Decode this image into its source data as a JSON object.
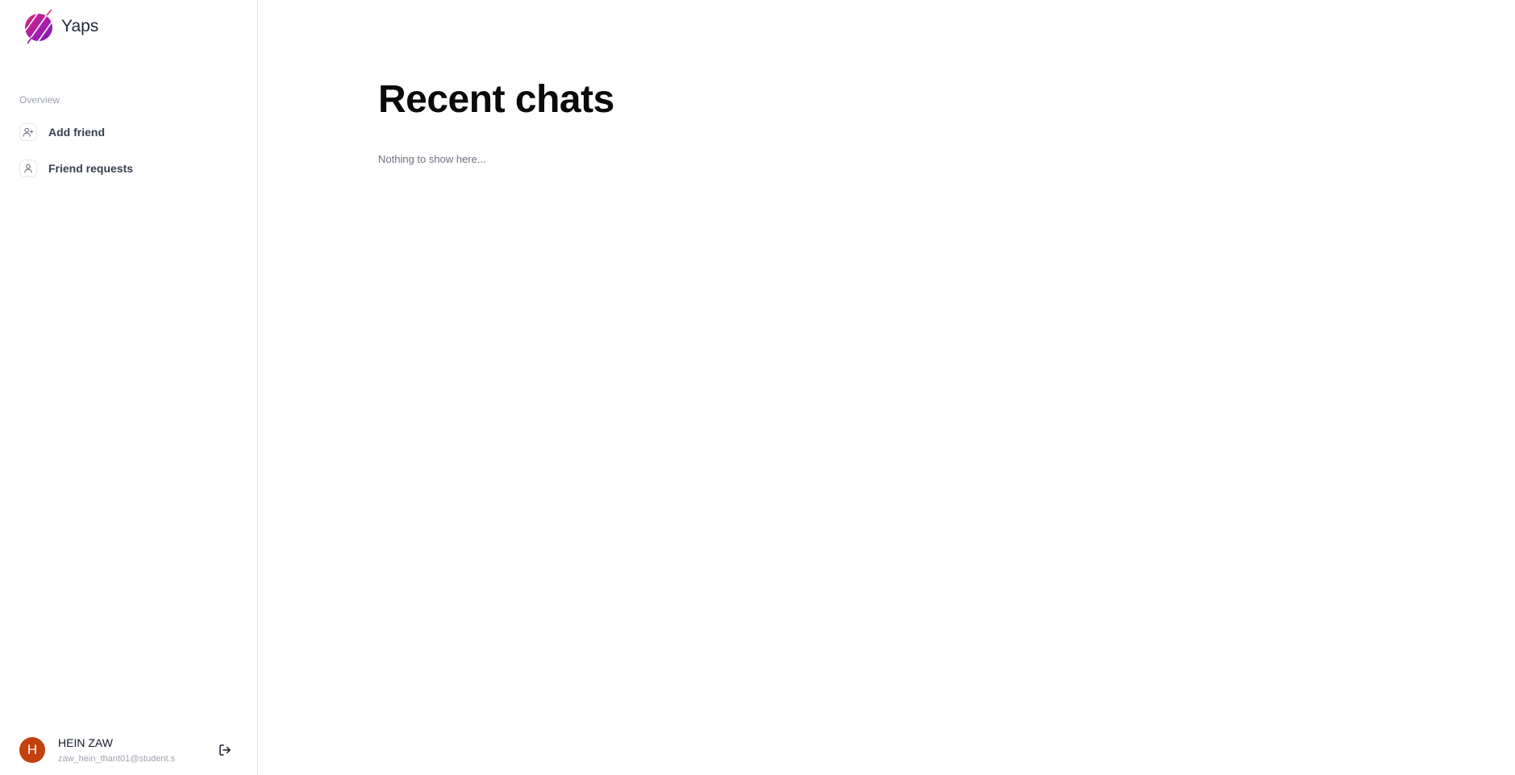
{
  "brand": {
    "name": "Yaps",
    "logo_icon": "yaps-logo-icon",
    "logo_colors": [
      "#a21caf",
      "#db2777",
      "#6b21a8"
    ]
  },
  "sidebar": {
    "section_label": "Overview",
    "items": [
      {
        "label": "Add friend",
        "icon": "user-plus-icon"
      },
      {
        "label": "Friend requests",
        "icon": "user-icon"
      }
    ]
  },
  "user": {
    "initial": "H",
    "name": "HEIN ZAW",
    "email": "zaw_hein_thant01@student.s",
    "avatar_color": "#c2410c",
    "logout_icon": "logout-icon"
  },
  "main": {
    "title": "Recent chats",
    "empty_message": "Nothing to show here..."
  }
}
